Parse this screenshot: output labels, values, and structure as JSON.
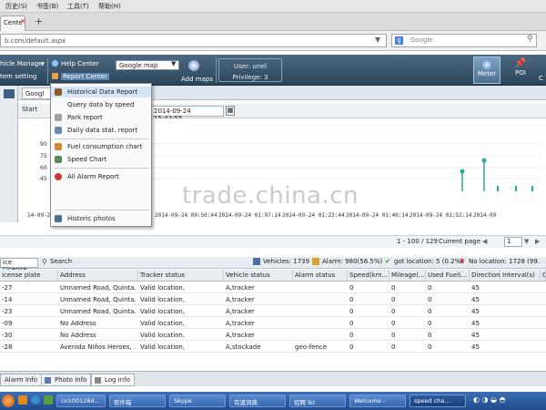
{
  "browser": {
    "menu": [
      "历史(S)",
      "书签(B)",
      "工具(T)",
      "帮助(H)"
    ],
    "tab_label": "Cente",
    "url": "b.com/default.aspx",
    "search_placeholder": "Google"
  },
  "app": {
    "vehicle_manager": "hicle Manager",
    "system_setting": "tem setting",
    "help_center": "Help Center",
    "report_center": "Report Center",
    "map_select": "Google map",
    "add_maps": "Add maps",
    "user_label": "User: uriel",
    "privilege_label": "Privilege: 3",
    "right_buttons": [
      "Meter",
      "POI"
    ]
  },
  "dropdown": {
    "items": [
      "Historical Data Report",
      "Query data by speed",
      "Park report",
      "Daily data stat. report",
      "Fuel consumption chart",
      "Speed Chart",
      "All Alarm Report",
      "Historic photos"
    ]
  },
  "map": {
    "tab_label": "Googl",
    "start_label": "Start",
    "end_time": "2014-09-24 15:43:55"
  },
  "chart_data": {
    "type": "line",
    "yticks": [
      "90",
      "75",
      "60",
      "45"
    ],
    "xticks": [
      "14-09-2",
      "014-09-24 00:34:14",
      "2014-09-24 00:50:44",
      "2014-09-24 01:07:14",
      "2014-09-24 01:23:44",
      "2014-09-24 01:40:14",
      "2014-09-24 01:52:14",
      "2014-09"
    ]
  },
  "pager": {
    "range": "1 - 100 / 129",
    "current_page": "Current page",
    "page_value": "1"
  },
  "grid": {
    "toolbar": {
      "license": "ice License",
      "search": "Search",
      "vehicles": "Vehicles: 1739",
      "alarm": "Alarm: 980(56.5%)",
      "got_location": "got location: 5 (0.2%)",
      "no_location": "No location: 1728 (99."
    },
    "columns": [
      "icense plate",
      "Address",
      "Tracker status",
      "Vehicle status",
      "Alarm status",
      "Speed(km...",
      "Mileage(...",
      "Used Fuel(...",
      "Direction",
      "Interval(s)",
      "C"
    ],
    "rows": [
      [
        "-27",
        "Unnamed Road, Quinta...",
        "Valid location,",
        "A,tracker",
        "",
        "0",
        "0",
        "0",
        "45",
        ""
      ],
      [
        "-14",
        "Unnamed Road, Quinta...",
        "Valid location,",
        "A,tracker",
        "",
        "0",
        "0",
        "0",
        "45",
        ""
      ],
      [
        "-23",
        "Unnamed Road, Quinta...",
        "Valid location,",
        "A,tracker",
        "",
        "0",
        "0",
        "0",
        "45",
        ""
      ],
      [
        "-09",
        "No Address",
        "Valid location,",
        "A,tracker",
        "",
        "0",
        "0",
        "0",
        "45",
        ""
      ],
      [
        "-30",
        "No Address",
        "Valid location,",
        "A,tracker",
        "",
        "0",
        "0",
        "0",
        "45",
        ""
      ],
      [
        "-28",
        "Avenida Niños Heroes, ...",
        "Valid location,",
        "A,stockade",
        "geo-fence",
        "0",
        "0",
        "0",
        "45",
        ""
      ]
    ]
  },
  "bottom_tabs": [
    "Alarm Info",
    "Photo Info",
    "Log Info"
  ],
  "taskbar": [
    "cn1001264...",
    "软件箱",
    "Skype",
    "有道词典",
    "招聘 Ikt",
    "Welcome -",
    "speed cha..."
  ],
  "watermark": "trade.china.cn"
}
